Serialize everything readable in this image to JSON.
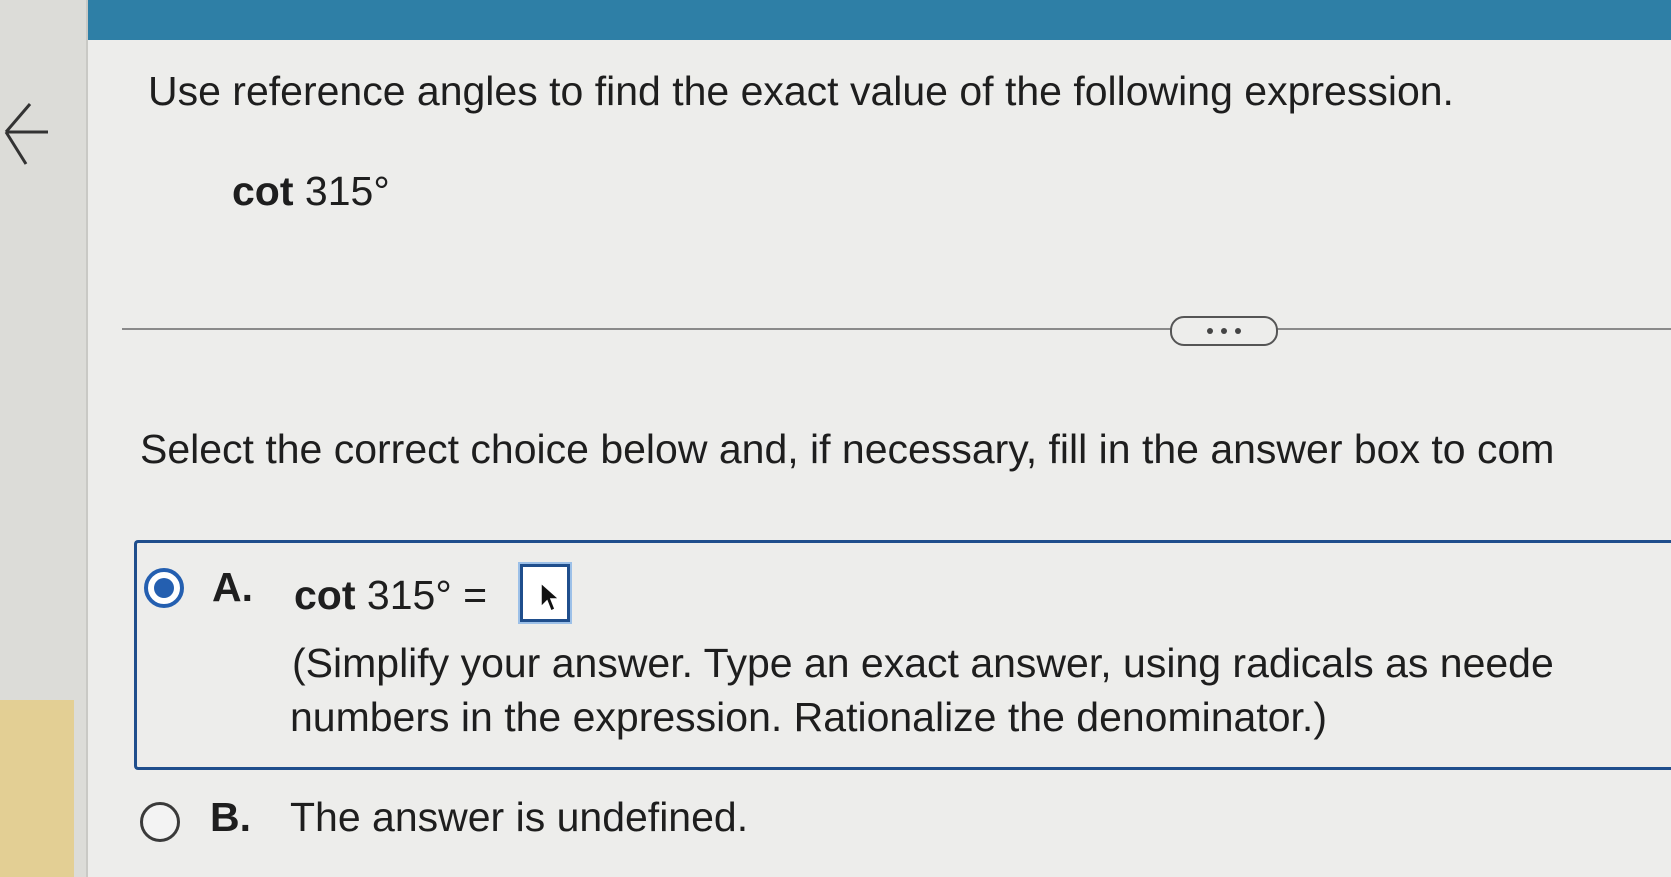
{
  "question": {
    "prompt": "Use reference angles to find the exact value of the following expression.",
    "expression_fn": "cot",
    "expression_arg": "315°"
  },
  "divider": {
    "more_label": "• • •"
  },
  "instruction": "Select the correct choice below and, if necessary, fill in the answer box to com",
  "choices": [
    {
      "letter": "A.",
      "selected": true,
      "expression_fn": "cot",
      "expression_arg": "315° =",
      "answer_value": "",
      "hint_line1": "(Simplify your answer. Type an exact answer, using radicals as neede",
      "hint_line2": "numbers in the expression. Rationalize the denominator.)"
    },
    {
      "letter": "B.",
      "selected": false,
      "text": "The answer is undefined."
    }
  ],
  "colors": {
    "accent": "#245fb0",
    "topbar": "#2e7fa6",
    "box_border": "#1f4e8c"
  },
  "icons": [
    "back-arrow-icon",
    "more-options-icon",
    "mouse-cursor-icon"
  ]
}
